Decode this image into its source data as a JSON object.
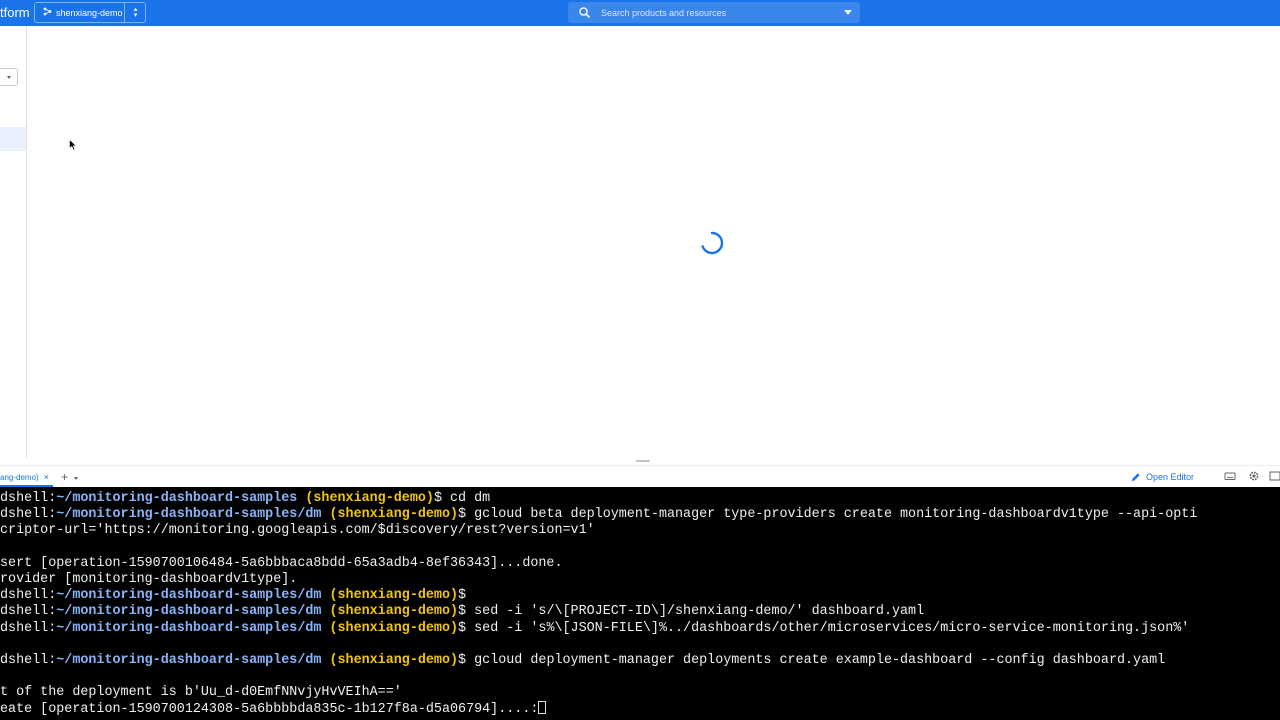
{
  "header": {
    "brand": "tform",
    "project_name": "shenxiang-demo",
    "search_placeholder": "Search products and resources"
  },
  "colors": {
    "topbar": "#1a73e8",
    "prompt_path": "#8ab4f8",
    "prompt_project": "#f1c40f",
    "terminal_bg": "#000000"
  },
  "shell": {
    "tab_label": "ang-demo)",
    "open_editor_label": "Open Editor",
    "lines": [
      {
        "user": "dshell:",
        "path": "~/monitoring-dashboard-samples",
        "project": " (shenxiang-demo)",
        "cmd": "$ cd dm"
      },
      {
        "user": "dshell:",
        "path": "~/monitoring-dashboard-samples/dm",
        "project": " (shenxiang-demo)",
        "cmd": "$ gcloud beta deployment-manager type-providers create monitoring-dashboardv1type --api-opti"
      },
      {
        "text": "criptor-url='https://monitoring.googleapis.com/$discovery/rest?version=v1'"
      },
      {
        "text": ""
      },
      {
        "text": "sert [operation-1590700106484-5a6bbbaca8bdd-65a3adb4-8ef36343]...done."
      },
      {
        "text": "rovider [monitoring-dashboardv1type]."
      },
      {
        "user": "dshell:",
        "path": "~/monitoring-dashboard-samples/dm",
        "project": " (shenxiang-demo)",
        "cmd": "$"
      },
      {
        "user": "dshell:",
        "path": "~/monitoring-dashboard-samples/dm",
        "project": " (shenxiang-demo)",
        "cmd": "$ sed -i 's/\\[PROJECT-ID\\]/shenxiang-demo/' dashboard.yaml"
      },
      {
        "user": "dshell:",
        "path": "~/monitoring-dashboard-samples/dm",
        "project": " (shenxiang-demo)",
        "cmd": "$ sed -i 's%\\[JSON-FILE\\]%../dashboards/other/microservices/micro-service-monitoring.json%'"
      },
      {
        "text": ""
      },
      {
        "user": "dshell:",
        "path": "~/monitoring-dashboard-samples/dm",
        "project": " (shenxiang-demo)",
        "cmd": "$ gcloud deployment-manager deployments create example-dashboard --config dashboard.yaml"
      },
      {
        "text": ""
      },
      {
        "text": "t of the deployment is b'Uu_d-d0EmfNNvjyHvVEIhA=='"
      },
      {
        "text": "eate [operation-1590700124308-5a6bbbbda835c-1b127f8a-d5a06794]....:",
        "cursor": true
      }
    ]
  }
}
